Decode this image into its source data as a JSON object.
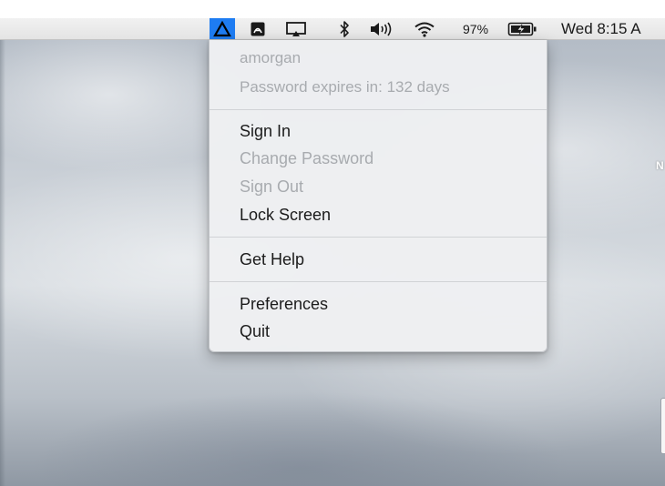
{
  "menubar": {
    "icons": [
      {
        "name": "enterprise-connect-icon",
        "active": true
      },
      {
        "name": "acrobat-icon",
        "active": false
      },
      {
        "name": "airplay-icon",
        "active": false
      },
      {
        "name": "bluetooth-icon",
        "active": false
      },
      {
        "name": "volume-icon",
        "active": false
      },
      {
        "name": "wifi-icon",
        "active": false
      },
      {
        "name": "battery-charging-icon",
        "active": false
      }
    ],
    "battery_percent": "97%",
    "clock": "Wed 8:15 A",
    "accent_color": "#1e7cf2"
  },
  "menu": {
    "header": {
      "username": "amorgan",
      "password_expiry": "Password expires in: 132 days"
    },
    "sign_in": "Sign In",
    "change_password": "Change Password",
    "sign_out": "Sign Out",
    "lock_screen": "Lock Screen",
    "get_help": "Get Help",
    "preferences": "Preferences",
    "quit": "Quit"
  },
  "desktop": {
    "partial_label": "N"
  }
}
